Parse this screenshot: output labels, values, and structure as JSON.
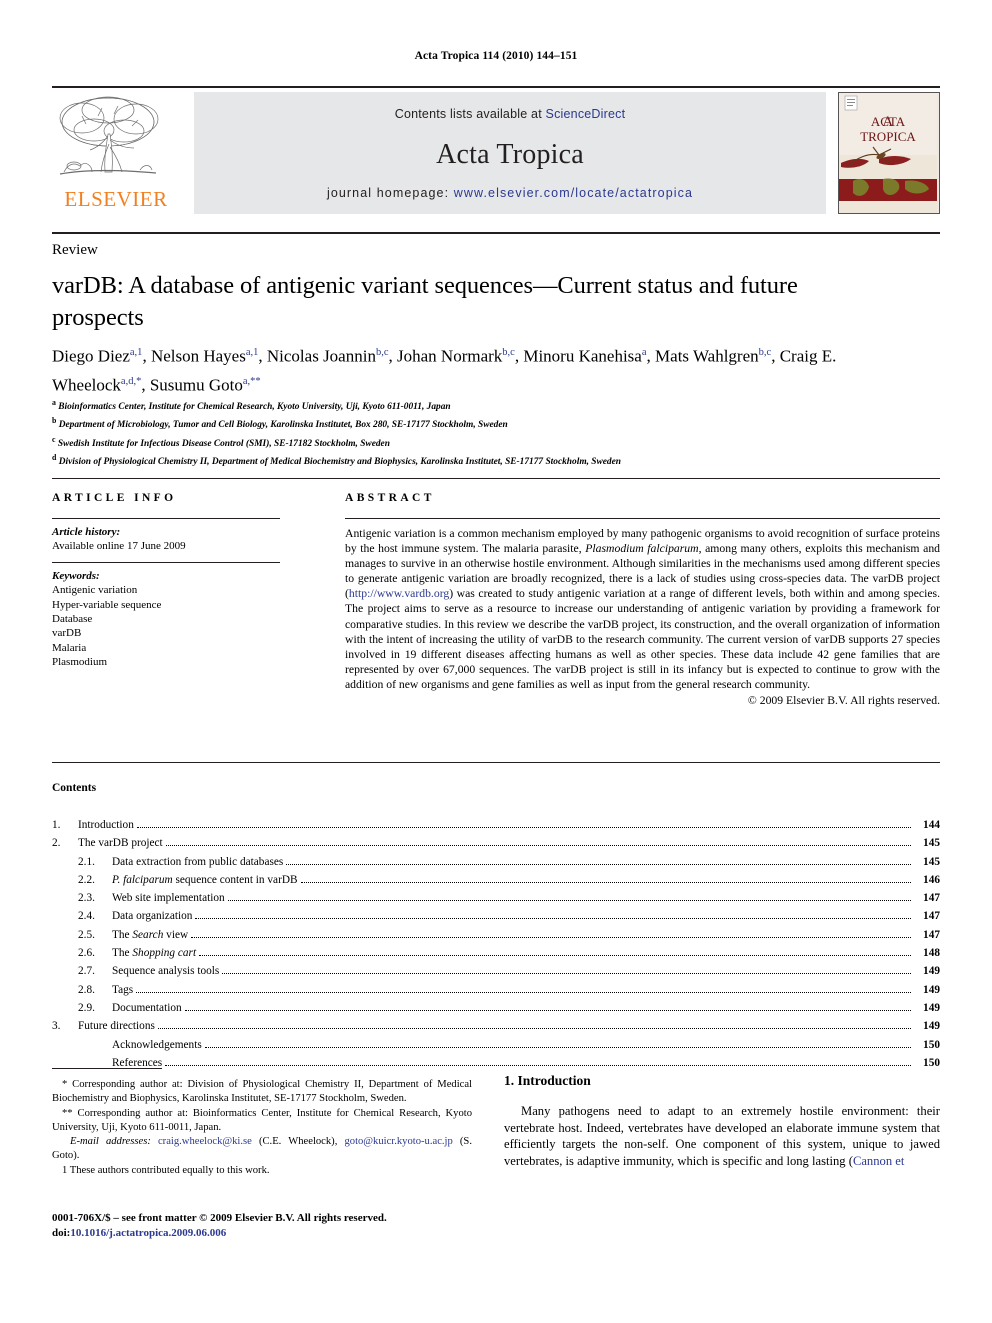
{
  "running_head": "Acta Tropica 114 (2010) 144–151",
  "masthead": {
    "contents_lists_prefix": "Contents lists available at ",
    "sciencedirect": "ScienceDirect",
    "journal_name": "Acta Tropica",
    "homepage_label": "journal homepage: ",
    "homepage_url": "www.elsevier.com/locate/actatropica",
    "publisher": "ELSEVIER",
    "cover_title_line1": "ACTA",
    "cover_title_line2": "TROPICA",
    "accent_orange": "#f08122",
    "link_blue": "#2b3990",
    "band_gray": "#e6e7e8"
  },
  "article": {
    "type": "Review",
    "title": "varDB: A database of antigenic variant sequences—Current status and future prospects",
    "authors": [
      {
        "name": "Diego Diez",
        "sup": "a,1"
      },
      {
        "name": "Nelson Hayes",
        "sup": "a,1"
      },
      {
        "name": "Nicolas Joannin",
        "sup": "b,c"
      },
      {
        "name": "Johan Normark",
        "sup": "b,c"
      },
      {
        "name": "Minoru Kanehisa",
        "sup": "a"
      },
      {
        "name": "Mats Wahlgren",
        "sup": "b,c"
      },
      {
        "name": "Craig E. Wheelock",
        "sup": "a,d,*"
      },
      {
        "name": "Susumu Goto",
        "sup": "a,**"
      }
    ],
    "affiliations": [
      {
        "marker": "a",
        "text": "Bioinformatics Center, Institute for Chemical Research, Kyoto University, Uji, Kyoto 611-0011, Japan"
      },
      {
        "marker": "b",
        "text": "Department of Microbiology, Tumor and Cell Biology, Karolinska Institutet, Box 280, SE-17177 Stockholm, Sweden"
      },
      {
        "marker": "c",
        "text": "Swedish Institute for Infectious Disease Control (SMI), SE-17182 Stockholm, Sweden"
      },
      {
        "marker": "d",
        "text": "Division of Physiological Chemistry II, Department of Medical Biochemistry and Biophysics, Karolinska Institutet, SE-17177 Stockholm, Sweden"
      }
    ]
  },
  "info": {
    "heading": "ARTICLE INFO",
    "history_label": "Article history:",
    "history_value": "Available online 17 June 2009",
    "keywords_label": "Keywords:",
    "keywords": [
      "Antigenic variation",
      "Hyper-variable sequence",
      "Database",
      "varDB",
      "Malaria",
      "Plasmodium"
    ]
  },
  "abstract": {
    "heading": "ABSTRACT",
    "part1": "Antigenic variation is a common mechanism employed by many pathogenic organisms to avoid recognition of surface proteins by the host immune system. The malaria parasite, ",
    "italic1": "Plasmodium falciparum",
    "part2": ", among many others, exploits this mechanism and manages to survive in an otherwise hostile environment. Although similarities in the mechanisms used among different species to generate antigenic variation are broadly recognized, there is a lack of studies using cross-species data. The varDB project (",
    "link": "http://www.vardb.org",
    "part3": ") was created to study antigenic variation at a range of different levels, both within and among species. The project aims to serve as a resource to increase our understanding of antigenic variation by providing a framework for comparative studies. In this review we describe the varDB project, its construction, and the overall organization of information with the intent of increasing the utility of varDB to the research community. The current version of varDB supports 27 species involved in 19 different diseases affecting humans as well as other species. These data include 42 gene families that are represented by over 67,000 sequences. The varDB project is still in its infancy but is expected to continue to grow with the addition of new organisms and gene families as well as input from the general research community.",
    "copyright": "© 2009 Elsevier B.V. All rights reserved."
  },
  "contents": {
    "heading": "Contents",
    "rows": [
      {
        "num": "1.",
        "label": "Introduction",
        "page": "144",
        "level": 1
      },
      {
        "num": "2.",
        "label": "The varDB project",
        "page": "145",
        "level": 1
      },
      {
        "num": "2.1.",
        "label": "Data extraction from public databases",
        "page": "145",
        "level": 2
      },
      {
        "num": "2.2.",
        "label": "P. falciparum sequence content in varDB",
        "page": "146",
        "level": 2,
        "italic_prefix": "P. falciparum",
        "rest": " sequence content in varDB"
      },
      {
        "num": "2.3.",
        "label": "Web site implementation",
        "page": "147",
        "level": 2
      },
      {
        "num": "2.4.",
        "label": "Data organization",
        "page": "147",
        "level": 2
      },
      {
        "num": "2.5.",
        "label": "The Search view",
        "page": "147",
        "level": 2,
        "plain_prefix": "The ",
        "italic_mid": "Search",
        "rest": " view"
      },
      {
        "num": "2.6.",
        "label": "The Shopping cart",
        "page": "148",
        "level": 2,
        "plain_prefix": "The ",
        "italic_mid": "Shopping cart",
        "rest": ""
      },
      {
        "num": "2.7.",
        "label": "Sequence analysis tools",
        "page": "149",
        "level": 2
      },
      {
        "num": "2.8.",
        "label": "Tags",
        "page": "149",
        "level": 2
      },
      {
        "num": "2.9.",
        "label": "Documentation",
        "page": "149",
        "level": 2
      },
      {
        "num": "3.",
        "label": "Future directions",
        "page": "149",
        "level": 1
      },
      {
        "num": "",
        "label": "Acknowledgements",
        "page": "150",
        "level": 2
      },
      {
        "num": "",
        "label": "References",
        "page": "150",
        "level": 2
      }
    ]
  },
  "footnotes": {
    "corr1": "*  Corresponding author at: Division of Physiological Chemistry II, Department of Medical Biochemistry and Biophysics, Karolinska Institutet, SE-17177 Stockholm, Sweden.",
    "corr2": "**  Corresponding author at: Bioinformatics Center, Institute for Chemical Research, Kyoto University, Uji, Kyoto 611-0011, Japan.",
    "email_label": "E-mail addresses:",
    "email1": "craig.wheelock@ki.se",
    "email1_who": " (C.E. Wheelock),",
    "email2": "goto@kuicr.kyoto-u.ac.jp",
    "email2_who": " (S. Goto).",
    "equal_contrib": "1  These authors contributed equally to this work."
  },
  "footer": {
    "issn_line": "0001-706X/$ – see front matter © 2009 Elsevier B.V. All rights reserved.",
    "doi_label": "doi:",
    "doi_value": "10.1016/j.actatropica.2009.06.006"
  },
  "introduction": {
    "heading": "1. Introduction",
    "paragraph_part1": "Many pathogens need to adapt to an extremely hostile environment: their vertebrate host. Indeed, vertebrates have developed an elaborate immune system that efficiently targets the non-self. One component of this system, unique to jawed vertebrates, is adaptive immunity, which is specific and long lasting (",
    "citation": "Cannon et",
    "paragraph_part2": ""
  }
}
